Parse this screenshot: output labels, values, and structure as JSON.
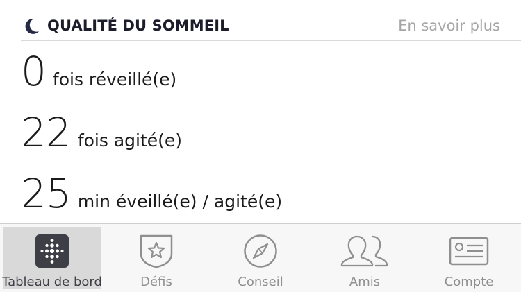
{
  "header": {
    "title": "QUALITÉ DU SOMMEIL",
    "learn_more": "En savoir plus",
    "icon": "moon-icon"
  },
  "stats": [
    {
      "value": "0",
      "label": "fois réveillé(e)"
    },
    {
      "value": "22",
      "label": "fois agité(e)"
    },
    {
      "value": "25",
      "label": "min éveillé(e) / agité(e)"
    }
  ],
  "tabs": [
    {
      "label": "Tableau de bord",
      "icon": "dashboard-icon",
      "active": true
    },
    {
      "label": "Défis",
      "icon": "star-badge-icon",
      "active": false
    },
    {
      "label": "Conseil",
      "icon": "compass-icon",
      "active": false
    },
    {
      "label": "Amis",
      "icon": "friends-icon",
      "active": false
    },
    {
      "label": "Compte",
      "icon": "account-card-icon",
      "active": false
    }
  ],
  "colors": {
    "title": "#1c1c2b",
    "muted": "#a6a6a6",
    "tab_bg": "#f7f7f7",
    "tab_active_bg": "#d9d9d9",
    "dashboard_icon_bg": "#3e3e46"
  }
}
